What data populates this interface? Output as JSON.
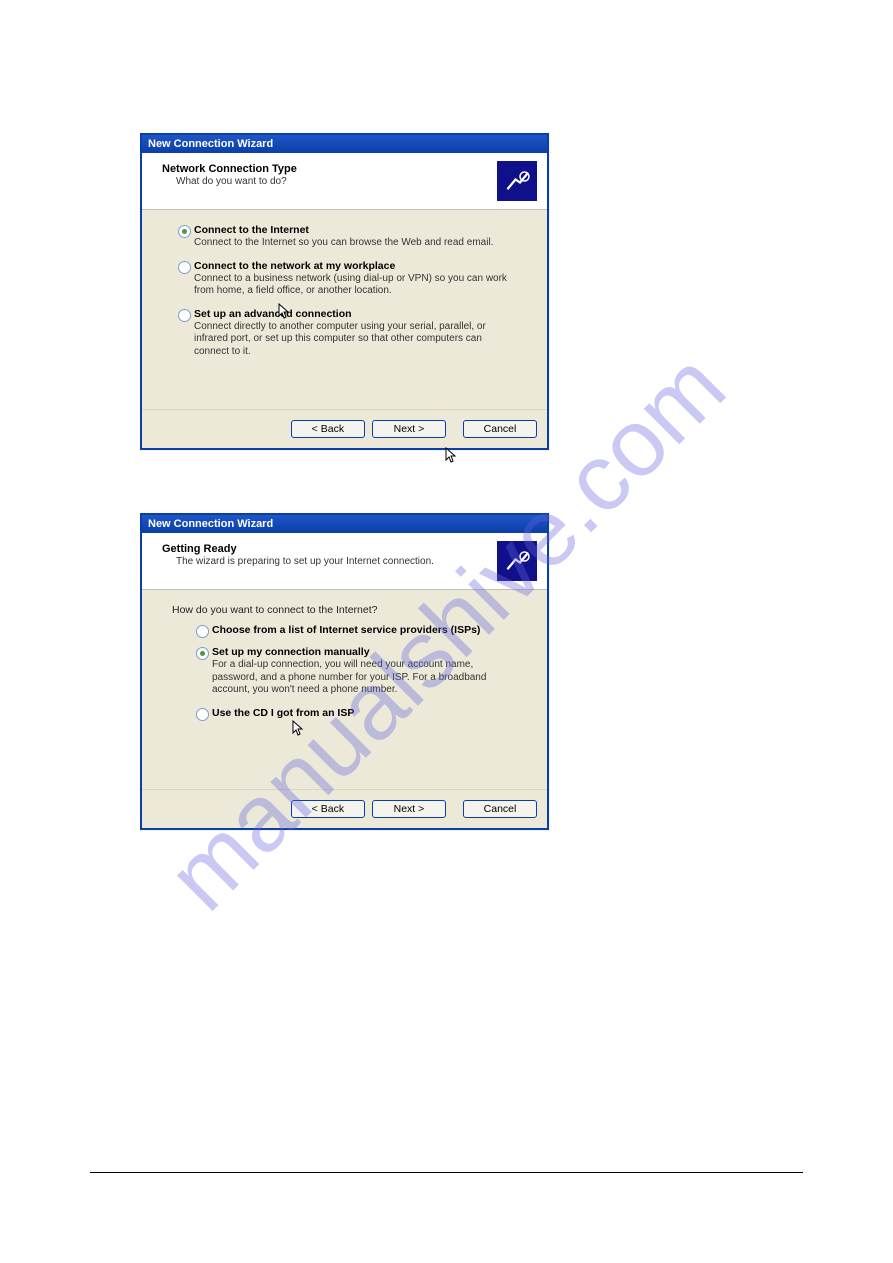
{
  "watermark": "manualshive.com",
  "wizard1": {
    "title": "New Connection Wizard",
    "header_title": "Network Connection Type",
    "header_sub": "What do you want to do?",
    "options": [
      {
        "label": "Connect to the Internet",
        "desc": "Connect to the Internet so you can browse the Web and read email."
      },
      {
        "label": "Connect to the network at my workplace",
        "desc": "Connect to a business network (using dial-up or VPN) so you can work from home, a field office, or another location."
      },
      {
        "label": "Set up an advanced connection",
        "desc": "Connect directly to another computer using your serial, parallel, or infrared port, or set up this computer so that other computers can connect to it."
      }
    ],
    "buttons": {
      "back": "< Back",
      "next": "Next >",
      "cancel": "Cancel"
    }
  },
  "wizard2": {
    "title": "New Connection Wizard",
    "header_title": "Getting Ready",
    "header_sub": "The wizard is preparing to set up your Internet connection.",
    "question": "How do you want to connect to the Internet?",
    "options": [
      {
        "label": "Choose from a list of Internet service providers (ISPs)",
        "desc": ""
      },
      {
        "label": "Set up my connection manually",
        "desc": "For a dial-up connection, you will need your account name, password, and a phone number for your ISP. For a broadband account, you won't need a phone number."
      },
      {
        "label": "Use the CD I got from an ISP",
        "desc": ""
      }
    ],
    "buttons": {
      "back": "< Back",
      "next": "Next >",
      "cancel": "Cancel"
    }
  }
}
